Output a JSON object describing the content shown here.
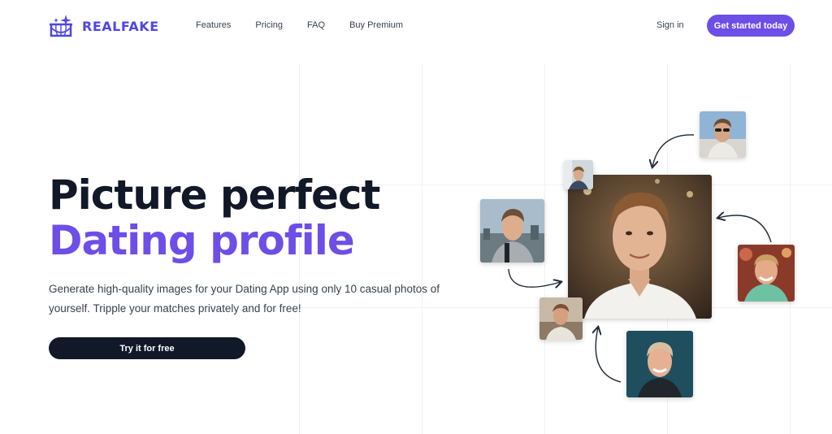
{
  "brand": {
    "name": "REALFAKE",
    "logo_icon": "globe-sparkle-icon",
    "accent": "#6d4ee6"
  },
  "nav": {
    "items": [
      "Features",
      "Pricing",
      "FAQ",
      "Buy Premium"
    ],
    "sign_in": "Sign in",
    "cta": "Get started today"
  },
  "hero": {
    "headline_line1": "Picture perfect",
    "headline_line2": "Dating profile",
    "subtitle": "Generate high-quality images for your Dating App using only 10 casual photos of yourself. Tripple your matches privately and for free!",
    "button": "Try it for free",
    "heading_color": "#111827",
    "highlight_color": "#6d4ee6"
  },
  "photos": [
    "main-portrait",
    "sunglasses-selfie",
    "small-top-portrait",
    "skyline-selfie",
    "smiling-outdoor-portrait",
    "sunset-selfie",
    "teal-studio-portrait"
  ]
}
